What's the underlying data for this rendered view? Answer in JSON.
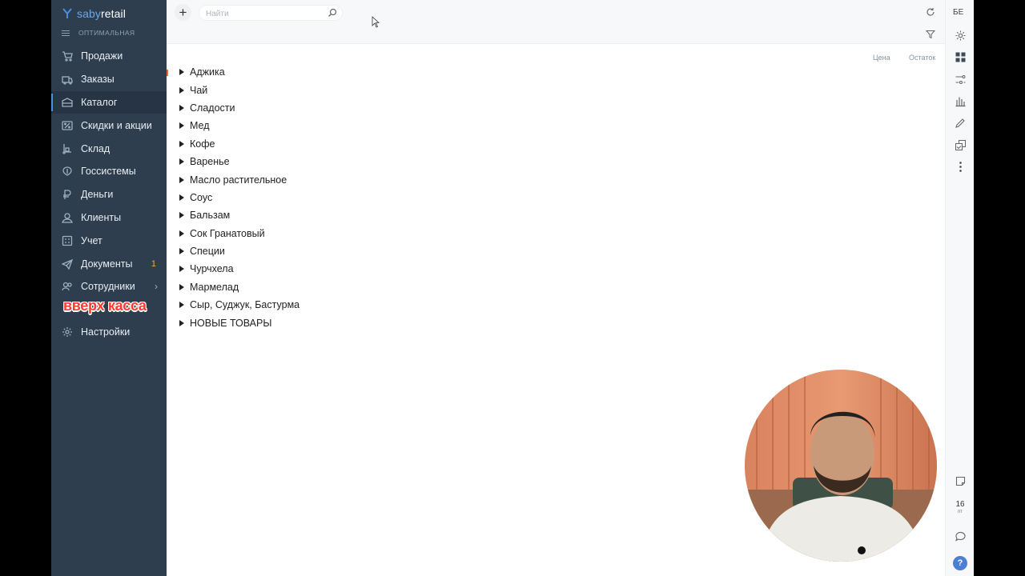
{
  "app": {
    "brand_prefix": "saby",
    "brand_suffix": "retail",
    "tariff": "ОПТИМАЛЬНАЯ"
  },
  "sidebar": {
    "items": [
      {
        "label": "Продажи",
        "icon": "cart-icon"
      },
      {
        "label": "Заказы",
        "icon": "orders-icon"
      },
      {
        "label": "Каталог",
        "icon": "catalog-icon",
        "active": true
      },
      {
        "label": "Скидки и акции",
        "icon": "percent-icon"
      },
      {
        "label": "Склад",
        "icon": "warehouse-icon"
      },
      {
        "label": "Госсистемы",
        "icon": "emblem-icon"
      },
      {
        "label": "Деньги",
        "icon": "ruble-icon"
      },
      {
        "label": "Клиенты",
        "icon": "clients-icon"
      },
      {
        "label": "Учет",
        "icon": "accounting-icon"
      },
      {
        "label": "Документы",
        "icon": "documents-icon",
        "count": "1"
      },
      {
        "label": "Сотрудники",
        "icon": "employees-icon",
        "chevron": "›"
      }
    ],
    "overlay_caption": "вверх касса",
    "settings_label": "Настройки"
  },
  "toolbar": {
    "add_label": "+",
    "search_placeholder": "Найти",
    "user_initials": "БЕ"
  },
  "columns": {
    "price": "Цена",
    "stock": "Остаток"
  },
  "catalog": {
    "folders": [
      "Аджика",
      "Чай",
      "Сладости",
      "Мед",
      "Кофе",
      "Варенье",
      "Масло растительное",
      "Соус",
      "Бальзам",
      "Сок Гранатовый",
      "Специи",
      "Чурчхела",
      "Мармелад",
      "Сыр, Суджук, Бастурма",
      "НОВЫЕ ТОВАРЫ"
    ]
  },
  "calendar": {
    "day": "16",
    "weekday": "пт"
  },
  "help_label": "?",
  "colors": {
    "sidebar_bg": "#2e3e4f",
    "accent": "#4a90e2",
    "caption": "#ff3b2f",
    "badge": "#f0a54a"
  }
}
